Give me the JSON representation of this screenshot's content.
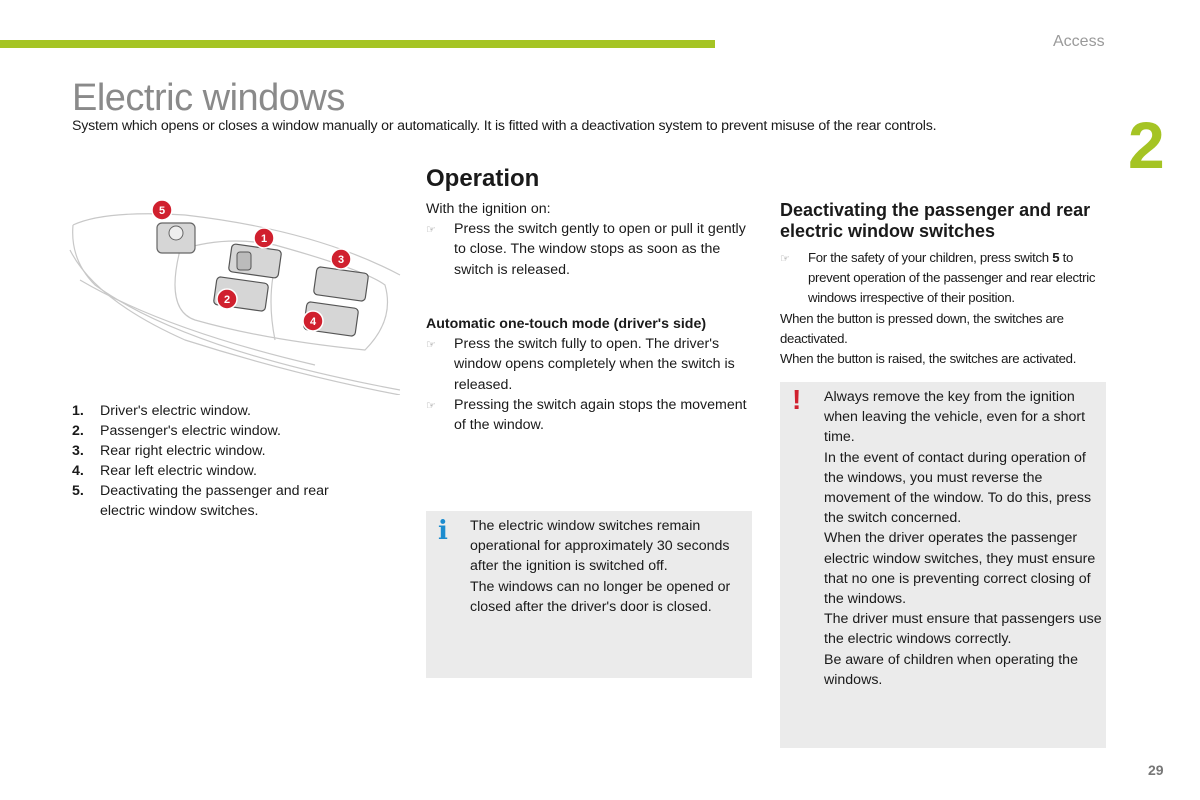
{
  "header": {
    "chapter_title": "Access",
    "chapter_number": "2",
    "accent_color": "#a5c424"
  },
  "page": {
    "title": "Electric windows",
    "subtitle": "System which opens or closes a window manually or automatically. It is fitted with a deactivation system to prevent misuse of the rear controls.",
    "number": "29"
  },
  "diagram": {
    "callouts": [
      "1",
      "2",
      "3",
      "4",
      "5"
    ],
    "callout_color": "#d0202e"
  },
  "legend": [
    {
      "num": "1.",
      "text": "Driver's electric window."
    },
    {
      "num": "2.",
      "text": "Passenger's electric window."
    },
    {
      "num": "3.",
      "text": "Rear right electric window."
    },
    {
      "num": "4.",
      "text": "Rear left electric window."
    },
    {
      "num": "5.",
      "text": "Deactivating the passenger and rear electric window switches."
    }
  ],
  "operation": {
    "heading": "Operation",
    "intro": "With the ignition on:",
    "bullet_icon": "☞",
    "bullets": [
      "Press the switch gently to open or pull it gently to close. The window stops as soon as the switch is released."
    ],
    "auto_heading": "Automatic one-touch mode (driver's side)",
    "auto_bullets": [
      "Press the switch fully to open. The driver's window opens completely when the switch is released.",
      "Pressing the switch again stops the movement of the window."
    ]
  },
  "info_box": {
    "icon": "i",
    "lines": [
      "The electric window switches remain operational for approximately 30 seconds after the ignition is switched off.",
      "The windows can no longer be opened or closed after the driver's door is closed."
    ]
  },
  "deactivation": {
    "heading": "Deactivating the passenger and rear electric window switches",
    "bullet_text": "For the safety of your children, press switch ",
    "bullet_bold": "5",
    "bullet_rest": " to prevent operation of the passenger and rear electric windows irrespective of their position.",
    "pressed": "When the button is pressed down, the switches are deactivated.",
    "raised": "When the button is raised, the switches are activated."
  },
  "warning_box": {
    "icon": "!",
    "paragraphs": [
      "Always remove the key from the ignition when leaving the vehicle, even for a short time.",
      "In the event of contact during operation of the windows, you must reverse the movement of the window. To do this, press the switch concerned.",
      "When the driver operates the passenger electric window switches, they must ensure that no one is preventing correct closing of the windows.",
      "The driver must ensure that passengers use the electric windows correctly.",
      "Be aware of children when operating the windows."
    ]
  }
}
